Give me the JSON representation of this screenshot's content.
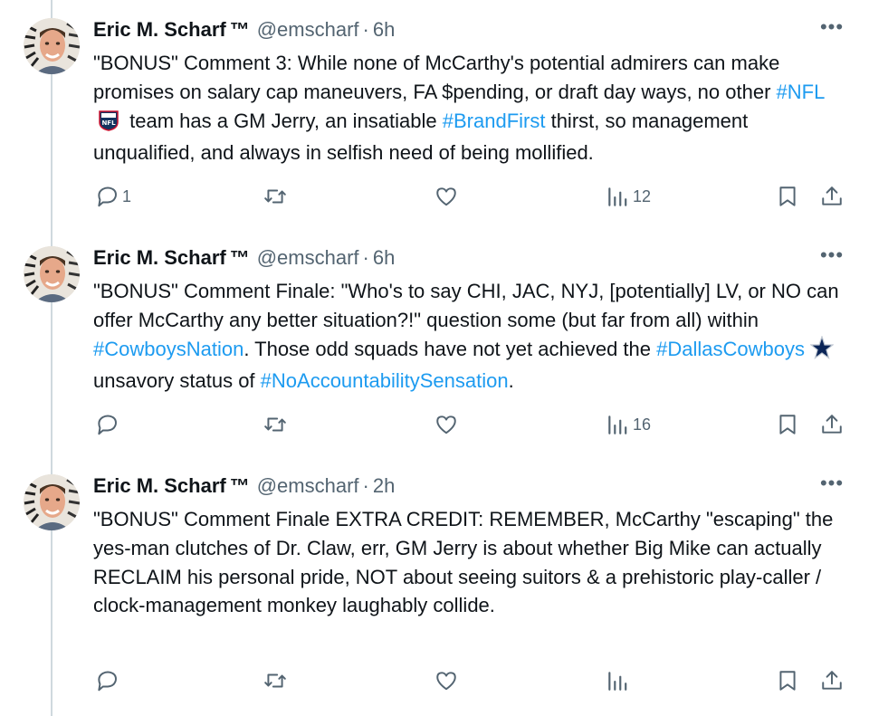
{
  "tweets": [
    {
      "author": "Eric M. Scharf",
      "tm": "™",
      "handle": "@emscharf",
      "separator": "·",
      "time": "6h",
      "more": "•••",
      "body": [
        {
          "t": "\"BONUS\" Comment 3: While none of McCarthy's potential admirers can make promises on salary cap maneuvers, FA $pending, or draft day ways, no other "
        },
        {
          "tag": "#NFL"
        },
        {
          "emoji": "nfl-shield-emoji"
        },
        {
          "t": " team has a GM Jerry, an insatiable "
        },
        {
          "tag": "#BrandFirst"
        },
        {
          "t": " thirst, so management unqualified, and always in selfish need of being mollified."
        }
      ],
      "reply_count": "1",
      "views_count": "12"
    },
    {
      "author": "Eric M. Scharf",
      "tm": "™",
      "handle": "@emscharf",
      "separator": "·",
      "time": "6h",
      "more": "•••",
      "body": [
        {
          "t": "\"BONUS\" Comment Finale: \"Who's to say CHI, JAC, NYJ, [potentially] LV, or NO can offer McCarthy any better situation?!\" question some (but far from all) within "
        },
        {
          "tag": "#CowboysNation"
        },
        {
          "t": ". Those odd squads have not yet achieved the "
        },
        {
          "tag": "#DallasCowboys"
        },
        {
          "emoji": "cowboys-star-emoji"
        },
        {
          "t": " unsavory status of "
        },
        {
          "tag": "#NoAccountabilitySensation"
        },
        {
          "t": "."
        }
      ],
      "reply_count": "",
      "views_count": "16"
    },
    {
      "author": "Eric M. Scharf",
      "tm": "™",
      "handle": "@emscharf",
      "separator": "·",
      "time": "2h",
      "more": "•••",
      "body": [
        {
          "t": "\"BONUS\" Comment Finale EXTRA CREDIT: REMEMBER, McCarthy \"escaping\" the yes-man clutches of Dr. Claw, err, GM Jerry is about whether Big Mike can actually RECLAIM his personal pride, NOT about seeing suitors & a prehistoric play-caller / clock-management monkey laughably collide."
        }
      ],
      "reply_count": "",
      "views_count": ""
    }
  ],
  "colors": {
    "link": "#1d9bf0",
    "muted": "#536471",
    "text": "#0f1419",
    "thread_line": "#cfd9de"
  },
  "icons": [
    "reply-icon",
    "retweet-icon",
    "like-icon",
    "views-icon",
    "bookmark-icon",
    "share-icon",
    "more-icon"
  ]
}
